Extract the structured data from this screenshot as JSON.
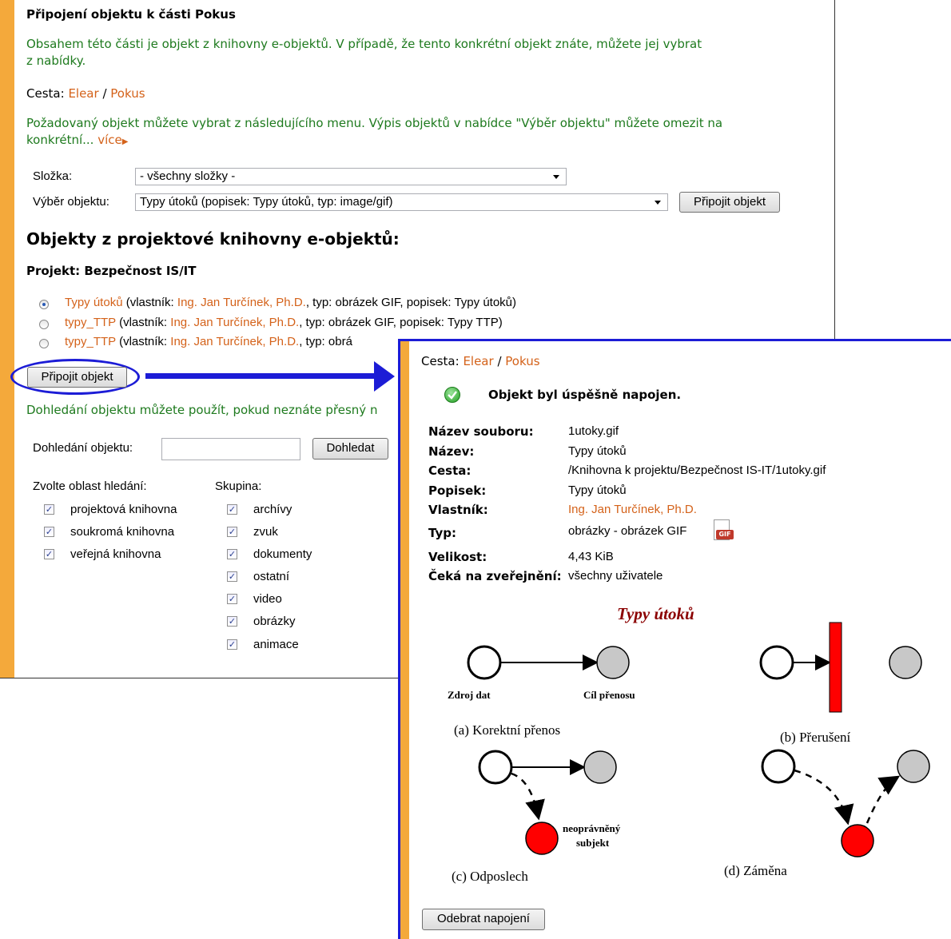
{
  "left": {
    "heading": "Připojení objektu k části Pokus",
    "intro": "Obsahem této části je objekt z knihovny e-objektů. V případě, že tento konkrétní objekt znáte, můžete jej vybrat z nabídky.",
    "intro_line1": "Obsahem této části je objekt z knihovny e-objektů. V případě, že tento konkrétní objekt znáte, můžete jej vybrat",
    "intro_line2": "z nabídky.",
    "path_label": "Cesta:",
    "path": [
      "Elear",
      "Pokus"
    ],
    "path_sep": "/",
    "select_info_line1": "Požadovaný objekt můžete vybrat z následujícího menu. Výpis objektů v nabídce \"Výběr objektu\" můžete omezit na",
    "select_info_line2": "konkrétní...",
    "more_link": "více",
    "folder_label": "Složka:",
    "folder_value": "- všechny složky -",
    "object_label": "Výběr objektu:",
    "object_value": "Typy útoků (popisek: Typy útoků, typ: image/gif)",
    "attach_btn_top": "Připojit objekt",
    "library_heading": "Objekty z projektové knihovny e-objektů:",
    "project_heading": "Projekt: Bezpečnost IS/IT",
    "objects": [
      {
        "name": "Typy útoků",
        "pre": " (vlastník: ",
        "owner": "Ing. Jan Turčínek, Ph.D.",
        "post": ", typ: obrázek GIF, popisek: Typy útoků)",
        "selected": true
      },
      {
        "name": "typy_TTP",
        "pre": " (vlastník: ",
        "owner": "Ing. Jan Turčínek, Ph.D.",
        "post": ", typ: obrázek GIF, popisek: Typy TTP)",
        "selected": false
      },
      {
        "name": "typy_TTP",
        "pre": " (vlastník: ",
        "owner": "Ing. Jan Turčínek, Ph.D.",
        "post": ", typ: obrá",
        "selected": false
      }
    ],
    "attach_btn": "Připojit objekt",
    "search_info": "Dohledání objektu můžete použít, pokud neznáte přesný n",
    "search_label": "Dohledání objektu:",
    "search_value": "",
    "search_btn": "Dohledat",
    "area_label": "Zvolte oblast hledání:",
    "areas": [
      "projektová knihovna",
      "soukromá knihovna",
      "veřejná knihovna"
    ],
    "group_label": "Skupina:",
    "groups": [
      "archívy",
      "zvuk",
      "dokumenty",
      "ostatní",
      "video",
      "obrázky",
      "animace"
    ]
  },
  "right": {
    "path_label": "Cesta:",
    "path": [
      "Elear",
      "Pokus"
    ],
    "path_sep": "/",
    "success": "Objekt byl úspěšně napojen.",
    "fields": {
      "filename_label": "Název souboru:",
      "filename": "1utoky.gif",
      "name_label": "Název:",
      "name": "Typy útoků",
      "path_label": "Cesta:",
      "path": "/Knihovna k projektu/Bezpečnost IS-IT/1utoky.gif",
      "desc_label": "Popisek:",
      "desc": "Typy útoků",
      "owner_label": "Vlastník:",
      "owner": "Ing. Jan Turčínek, Ph.D.",
      "type_label": "Typ:",
      "type": "obrázky - obrázek GIF",
      "size_label": "Velikost:",
      "size": "4,43 KiB",
      "publish_label": "Čeká na zveřejnění:",
      "publish": "všechny uživatele"
    },
    "gif_badge": "GIF",
    "diagram": {
      "title": "Typy útoků",
      "source": "Zdroj dat",
      "target": "Cíl přenosu",
      "a": "(a) Korektní přenos",
      "b": "(b) Přerušení",
      "c": "(c) Odposlech",
      "d": "(d) Záměna",
      "unauth_1": "neoprávněný",
      "unauth_2": "subjekt"
    },
    "remove_btn": "Odebrat napojení"
  },
  "colors": {
    "accent_bar": "#f4a93b",
    "link": "#d4621a",
    "green_text": "#1e7a1e",
    "highlight_blue": "#1c1cd6",
    "diagram_red": "#ff0000",
    "diagram_gray": "#c8c8c8",
    "diagram_title": "#8b0000"
  }
}
